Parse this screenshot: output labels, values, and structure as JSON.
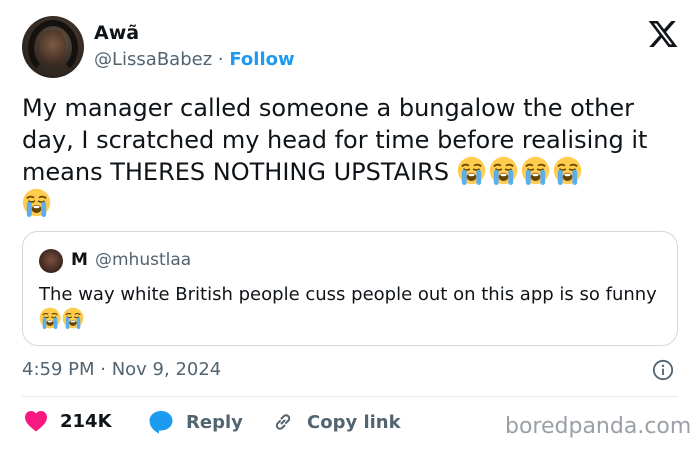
{
  "author": {
    "name": "Awã",
    "handle": "@LissaBabez",
    "separator": "·",
    "follow_label": "Follow"
  },
  "tweet": {
    "text": "My manager called someone a bungalow the other day, I scratched my head for time before realising it means THERES NOTHING UPSTAIRS",
    "emoji": [
      "loudly-crying-face",
      "loudly-crying-face",
      "loudly-crying-face",
      "loudly-crying-face",
      "loudly-crying-face"
    ]
  },
  "quoted_tweet": {
    "name": "M",
    "handle": "@mhustlaa",
    "text": "The way white British people cuss people out on this app is so funny",
    "emoji": [
      "loudly-crying-face",
      "loudly-crying-face"
    ]
  },
  "timestamp": "4:59 PM · Nov 9, 2024",
  "actions": {
    "likes": "214K",
    "reply": "Reply",
    "copy_link": "Copy link"
  },
  "watermark": "boredpanda.com",
  "colors": {
    "accent": "#1d9bf0",
    "like": "#f91880",
    "muted": "#536471",
    "border": "#cfd9de"
  },
  "icons": [
    "x-logo-icon",
    "info-icon",
    "heart-icon",
    "reply-bubble-icon",
    "link-icon"
  ]
}
